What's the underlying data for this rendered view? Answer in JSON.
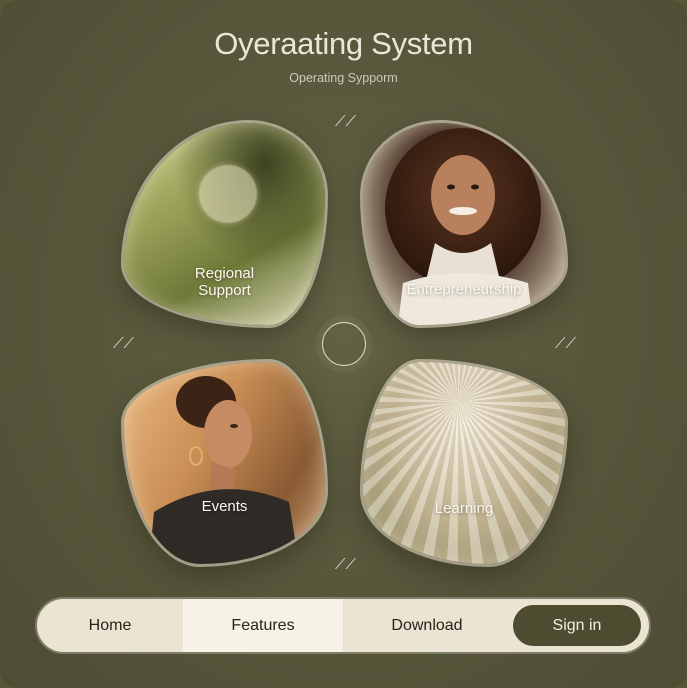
{
  "header": {
    "title": "Oyeraating System",
    "subtitle": "Operating Sypporm"
  },
  "cards": [
    {
      "label_line1": "Regional",
      "label_line2": "Support"
    },
    {
      "label": "Entrepreneurship"
    },
    {
      "label": "Events"
    },
    {
      "label": "Learning"
    }
  ],
  "nav": {
    "items": [
      "Home",
      "Features",
      "Download"
    ],
    "signin": "Sign in"
  },
  "colors": {
    "background": "#575638",
    "nav_bg": "#ebe4d2",
    "nav_active": "#f7f2e6",
    "signin_bg": "#4d4c30"
  }
}
